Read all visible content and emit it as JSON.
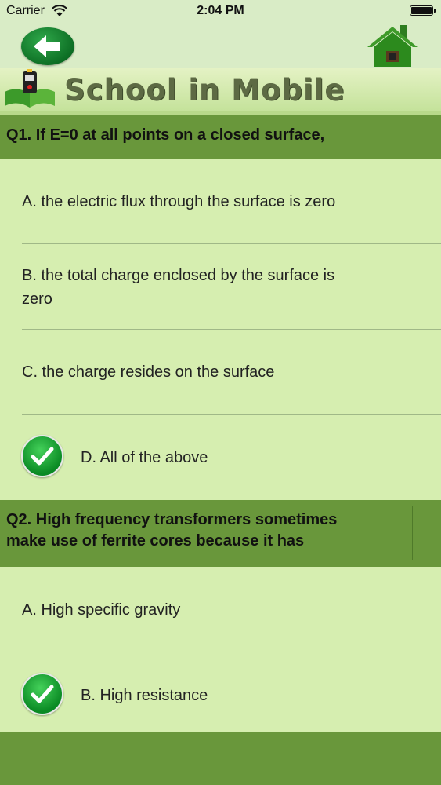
{
  "status_bar": {
    "carrier": "Carrier",
    "time": "2:04 PM"
  },
  "banner": {
    "title": "School in Mobile"
  },
  "colors": {
    "header_green": "#69973b",
    "background": "#d6eeb0",
    "check_green": "#1a9e35"
  },
  "questions": [
    {
      "title_lines": [
        "Q1. If E=0 at all points on a closed surface,"
      ],
      "options": [
        {
          "label": "A. the electric flux through the surface is zero",
          "correct": false
        },
        {
          "label_lines": [
            "B. the total charge enclosed by the surface is",
            "zero"
          ],
          "correct": false
        },
        {
          "label": "C. the charge resides on the surface",
          "correct": false
        },
        {
          "label": "D. All of the above",
          "correct": true,
          "icon": "check-icon"
        }
      ]
    },
    {
      "title_lines": [
        "Q2. High frequency transformers sometimes",
        "make use of ferrite cores because it has"
      ],
      "options": [
        {
          "label": "A.  High specific gravity",
          "correct": false
        },
        {
          "label": "B. High resistance",
          "correct": true,
          "icon": "check-icon"
        }
      ]
    }
  ]
}
